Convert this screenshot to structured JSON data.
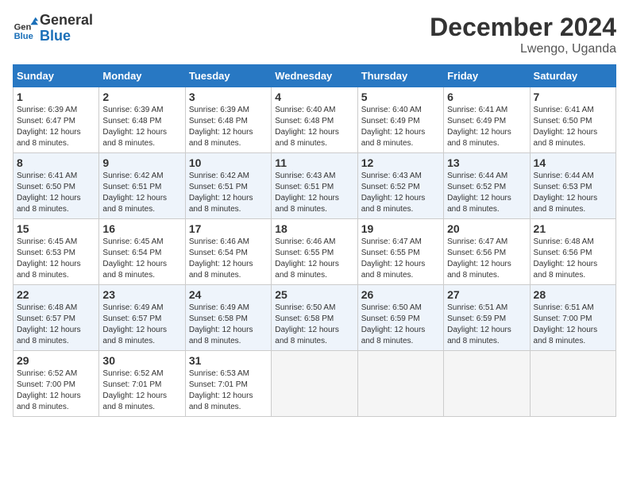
{
  "logo": {
    "line1": "General",
    "line2": "Blue"
  },
  "title": {
    "month_year": "December 2024",
    "location": "Lwengo, Uganda"
  },
  "weekdays": [
    "Sunday",
    "Monday",
    "Tuesday",
    "Wednesday",
    "Thursday",
    "Friday",
    "Saturday"
  ],
  "weeks": [
    [
      {
        "day": "1",
        "sunrise": "6:39 AM",
        "sunset": "6:47 PM",
        "daylight": "12 hours and 8 minutes."
      },
      {
        "day": "2",
        "sunrise": "6:39 AM",
        "sunset": "6:48 PM",
        "daylight": "12 hours and 8 minutes."
      },
      {
        "day": "3",
        "sunrise": "6:39 AM",
        "sunset": "6:48 PM",
        "daylight": "12 hours and 8 minutes."
      },
      {
        "day": "4",
        "sunrise": "6:40 AM",
        "sunset": "6:48 PM",
        "daylight": "12 hours and 8 minutes."
      },
      {
        "day": "5",
        "sunrise": "6:40 AM",
        "sunset": "6:49 PM",
        "daylight": "12 hours and 8 minutes."
      },
      {
        "day": "6",
        "sunrise": "6:41 AM",
        "sunset": "6:49 PM",
        "daylight": "12 hours and 8 minutes."
      },
      {
        "day": "7",
        "sunrise": "6:41 AM",
        "sunset": "6:50 PM",
        "daylight": "12 hours and 8 minutes."
      }
    ],
    [
      {
        "day": "8",
        "sunrise": "6:41 AM",
        "sunset": "6:50 PM",
        "daylight": "12 hours and 8 minutes."
      },
      {
        "day": "9",
        "sunrise": "6:42 AM",
        "sunset": "6:51 PM",
        "daylight": "12 hours and 8 minutes."
      },
      {
        "day": "10",
        "sunrise": "6:42 AM",
        "sunset": "6:51 PM",
        "daylight": "12 hours and 8 minutes."
      },
      {
        "day": "11",
        "sunrise": "6:43 AM",
        "sunset": "6:51 PM",
        "daylight": "12 hours and 8 minutes."
      },
      {
        "day": "12",
        "sunrise": "6:43 AM",
        "sunset": "6:52 PM",
        "daylight": "12 hours and 8 minutes."
      },
      {
        "day": "13",
        "sunrise": "6:44 AM",
        "sunset": "6:52 PM",
        "daylight": "12 hours and 8 minutes."
      },
      {
        "day": "14",
        "sunrise": "6:44 AM",
        "sunset": "6:53 PM",
        "daylight": "12 hours and 8 minutes."
      }
    ],
    [
      {
        "day": "15",
        "sunrise": "6:45 AM",
        "sunset": "6:53 PM",
        "daylight": "12 hours and 8 minutes."
      },
      {
        "day": "16",
        "sunrise": "6:45 AM",
        "sunset": "6:54 PM",
        "daylight": "12 hours and 8 minutes."
      },
      {
        "day": "17",
        "sunrise": "6:46 AM",
        "sunset": "6:54 PM",
        "daylight": "12 hours and 8 minutes."
      },
      {
        "day": "18",
        "sunrise": "6:46 AM",
        "sunset": "6:55 PM",
        "daylight": "12 hours and 8 minutes."
      },
      {
        "day": "19",
        "sunrise": "6:47 AM",
        "sunset": "6:55 PM",
        "daylight": "12 hours and 8 minutes."
      },
      {
        "day": "20",
        "sunrise": "6:47 AM",
        "sunset": "6:56 PM",
        "daylight": "12 hours and 8 minutes."
      },
      {
        "day": "21",
        "sunrise": "6:48 AM",
        "sunset": "6:56 PM",
        "daylight": "12 hours and 8 minutes."
      }
    ],
    [
      {
        "day": "22",
        "sunrise": "6:48 AM",
        "sunset": "6:57 PM",
        "daylight": "12 hours and 8 minutes."
      },
      {
        "day": "23",
        "sunrise": "6:49 AM",
        "sunset": "6:57 PM",
        "daylight": "12 hours and 8 minutes."
      },
      {
        "day": "24",
        "sunrise": "6:49 AM",
        "sunset": "6:58 PM",
        "daylight": "12 hours and 8 minutes."
      },
      {
        "day": "25",
        "sunrise": "6:50 AM",
        "sunset": "6:58 PM",
        "daylight": "12 hours and 8 minutes."
      },
      {
        "day": "26",
        "sunrise": "6:50 AM",
        "sunset": "6:59 PM",
        "daylight": "12 hours and 8 minutes."
      },
      {
        "day": "27",
        "sunrise": "6:51 AM",
        "sunset": "6:59 PM",
        "daylight": "12 hours and 8 minutes."
      },
      {
        "day": "28",
        "sunrise": "6:51 AM",
        "sunset": "7:00 PM",
        "daylight": "12 hours and 8 minutes."
      }
    ],
    [
      {
        "day": "29",
        "sunrise": "6:52 AM",
        "sunset": "7:00 PM",
        "daylight": "12 hours and 8 minutes."
      },
      {
        "day": "30",
        "sunrise": "6:52 AM",
        "sunset": "7:01 PM",
        "daylight": "12 hours and 8 minutes."
      },
      {
        "day": "31",
        "sunrise": "6:53 AM",
        "sunset": "7:01 PM",
        "daylight": "12 hours and 8 minutes."
      },
      null,
      null,
      null,
      null
    ]
  ],
  "labels": {
    "sunrise": "Sunrise:",
    "sunset": "Sunset:",
    "daylight": "Daylight:"
  }
}
